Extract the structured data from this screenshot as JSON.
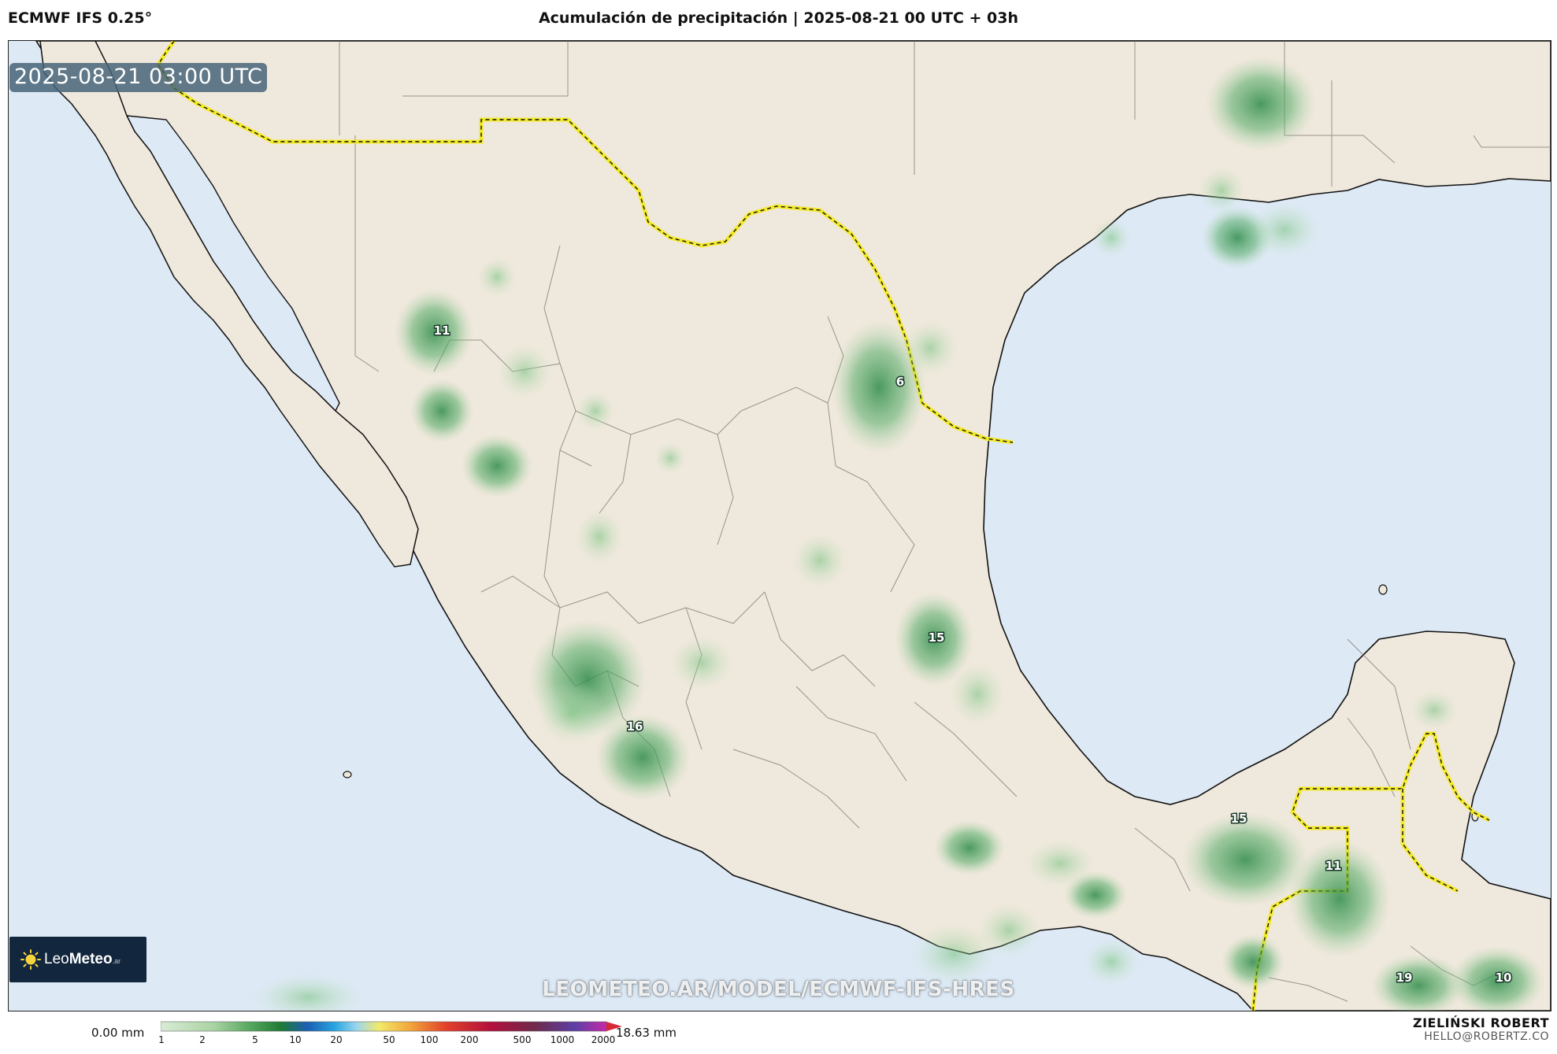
{
  "header": {
    "model": "ECMWF IFS 0.25°",
    "title": "Acumulación de precipitación | 2025-08-21 00 UTC + 03h"
  },
  "map": {
    "valid_time": "2025-08-21 03:00 UTC",
    "watermark": "LEOMETEO.AR/MODEL/ECMWF-IFS-HRES",
    "logo": {
      "text_bold": "Leo",
      "text_rest": "Meteo",
      "suffix": ".ar"
    },
    "colors": {
      "ocean": "#dde9f5",
      "land": "#efe8dc",
      "border": "#f3ea2a",
      "coast": "#111111"
    },
    "peaks": [
      {
        "label": "11"
      },
      {
        "label": "6"
      },
      {
        "label": "15"
      },
      {
        "label": "16"
      },
      {
        "label": "15"
      },
      {
        "label": "11"
      },
      {
        "label": "19"
      },
      {
        "label": "10"
      }
    ]
  },
  "legend": {
    "min_label": "0.00 mm",
    "max_label": "18.63 mm",
    "ticks": [
      "1",
      "2",
      "5",
      "10",
      "20",
      "50",
      "100",
      "200",
      "500",
      "1000",
      "2000"
    ]
  },
  "signature": {
    "name": "ZIELIŃSKI ROBERT",
    "email": "HELLO@ROBERTZ.CO"
  }
}
